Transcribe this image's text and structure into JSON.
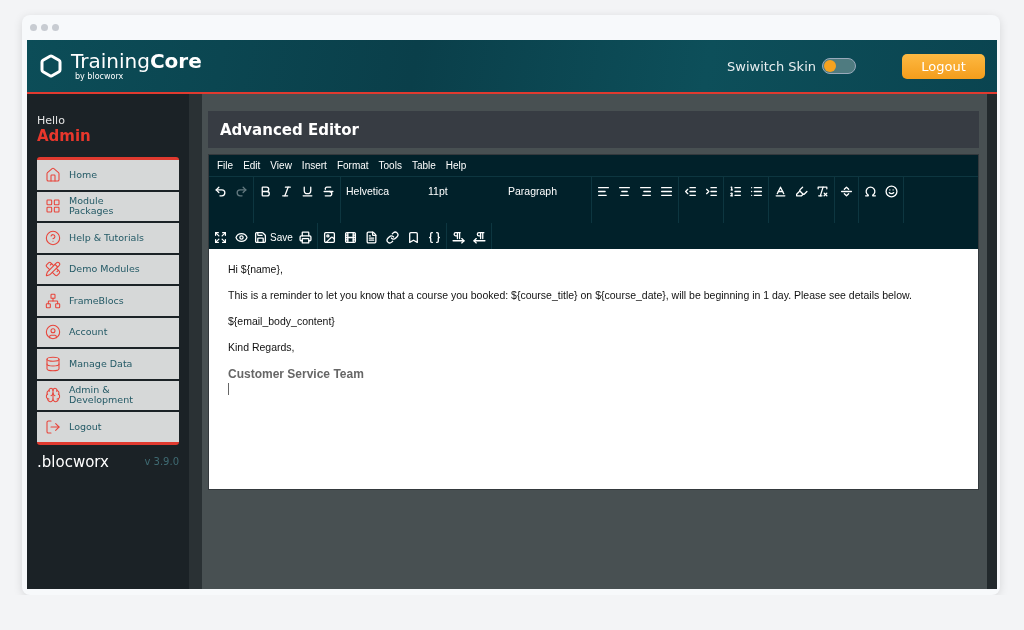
{
  "brand": {
    "name_light": "Training",
    "name_bold": "Core",
    "tagline": "by blocworx"
  },
  "header": {
    "skin_toggle": {
      "label": "Swiwitch Skin",
      "on": false
    },
    "logout": "Logout"
  },
  "sidebar": {
    "greeting": "Hello",
    "user": "Admin",
    "items": [
      {
        "label": "Home"
      },
      {
        "label": "Module Packages"
      },
      {
        "label": "Help & Tutorials"
      },
      {
        "label": "Demo Modules"
      },
      {
        "label": "FrameBlocs"
      },
      {
        "label": "Account"
      },
      {
        "label": "Manage Data"
      },
      {
        "label": "Admin & Development"
      },
      {
        "label": "Logout"
      }
    ],
    "footer_logo": ".blocworx",
    "version": "v 3.9.0"
  },
  "page_title": "Advanced Editor",
  "editor": {
    "menu": [
      "File",
      "Edit",
      "View",
      "Insert",
      "Format",
      "Tools",
      "Table",
      "Help"
    ],
    "toolbar": [
      [
        {
          "kind": "icon",
          "disabled": false
        },
        {
          "kind": "icon",
          "disabled": true
        }
      ],
      [
        {
          "kind": "icon",
          "disabled": false
        },
        {
          "kind": "icon",
          "disabled": false
        },
        {
          "kind": "icon",
          "disabled": false
        },
        {
          "kind": "icon",
          "disabled": false
        }
      ],
      [
        {
          "kind": "select",
          "label": "Helvetica"
        },
        {
          "kind": "select",
          "label": "11pt"
        },
        {
          "kind": "select",
          "label": "Paragraph"
        }
      ],
      [
        {
          "kind": "icon",
          "disabled": false
        },
        {
          "kind": "icon",
          "disabled": false
        },
        {
          "kind": "icon",
          "disabled": false
        },
        {
          "kind": "icon",
          "disabled": false
        }
      ],
      [
        {
          "kind": "icon",
          "disabled": false
        },
        {
          "kind": "icon",
          "disabled": false
        }
      ],
      [
        {
          "kind": "icon",
          "disabled": false
        },
        {
          "kind": "icon",
          "disabled": false
        }
      ],
      [
        {
          "kind": "icon",
          "disabled": false
        },
        {
          "kind": "icon",
          "disabled": false
        },
        {
          "kind": "icon",
          "disabled": false
        }
      ],
      [
        {
          "kind": "icon",
          "disabled": false
        }
      ],
      [
        {
          "kind": "icon",
          "disabled": false
        },
        {
          "kind": "icon",
          "disabled": false
        }
      ],
      [
        {
          "kind": "icon",
          "disabled": false
        },
        {
          "kind": "icon",
          "disabled": false
        },
        {
          "kind": "labeled",
          "label": "Save",
          "disabled": false
        },
        {
          "kind": "icon",
          "disabled": false
        }
      ],
      [
        {
          "kind": "icon",
          "disabled": false
        },
        {
          "kind": "icon",
          "disabled": false
        },
        {
          "kind": "icon",
          "disabled": false
        },
        {
          "kind": "icon",
          "disabled": false
        },
        {
          "kind": "icon",
          "disabled": false
        },
        {
          "kind": "icon",
          "disabled": false
        }
      ],
      [
        {
          "kind": "icon",
          "disabled": false
        },
        {
          "kind": "icon",
          "disabled": false
        }
      ]
    ],
    "content": [
      {
        "kind": "text",
        "text": "Hi ${name},"
      },
      {
        "kind": "text",
        "text": "This is a reminder to let you know that a course you booked: ${course_title} on ${course_date}, will be beginning in 1 day. Please see details below."
      },
      {
        "kind": "text",
        "text": "${email_body_content}"
      },
      {
        "kind": "text",
        "text": "Kind Regards,"
      },
      {
        "kind": "signature",
        "text": "Customer Service Team"
      }
    ]
  }
}
